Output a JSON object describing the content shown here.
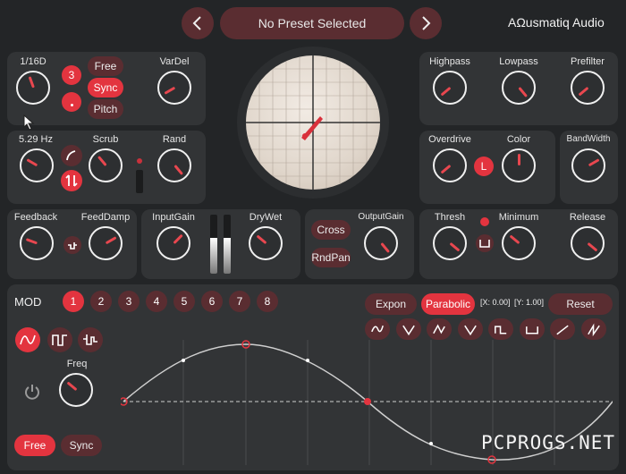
{
  "header": {
    "preset_name": "No Preset Selected",
    "brand": "AΩusmatiq Audio"
  },
  "delay": {
    "time_value": "1/16D",
    "num_value": "3",
    "mode_buttons": [
      "Free",
      "Sync",
      "Pitch"
    ],
    "vardel_label": "VarDel"
  },
  "lfo": {
    "rate_value": "5.29 Hz",
    "scrub_label": "Scrub",
    "rand_label": "Rand"
  },
  "feedback": {
    "feedback_label": "Feedback",
    "feeddamp_label": "FeedDamp"
  },
  "io": {
    "input_gain_label": "InputGain",
    "drywet_label": "DryWet"
  },
  "output": {
    "cross_label": "Cross",
    "rndpan_label": "RndPan",
    "outputgain_label": "OutputGain"
  },
  "filter": {
    "highpass_label": "Highpass",
    "lowpass_label": "Lowpass",
    "prefilter_label": "Prefilter"
  },
  "drive": {
    "overdrive_label": "Overdrive",
    "color_label": "Color",
    "l_label": "L",
    "bandwidth_label": "BandWidth"
  },
  "gate": {
    "thresh_label": "Thresh",
    "minimum_label": "Minimum",
    "release_label": "Release"
  },
  "mod": {
    "title": "MOD",
    "slots": [
      "1",
      "2",
      "3",
      "4",
      "5",
      "6",
      "7",
      "8"
    ],
    "active_slot": 1,
    "curve_buttons": [
      "Expon",
      "Parabolic"
    ],
    "x_readout": "[X: 0.00]",
    "y_readout": "[Y: 1.00]",
    "reset_label": "Reset",
    "freq_label": "Freq",
    "free_label": "Free",
    "sync_label": "Sync"
  },
  "watermark": "PCPROGS.NET",
  "colors": {
    "accent": "#e3343f",
    "dark_accent": "#5a2d31",
    "panel": "#323436",
    "background": "#232527"
  }
}
